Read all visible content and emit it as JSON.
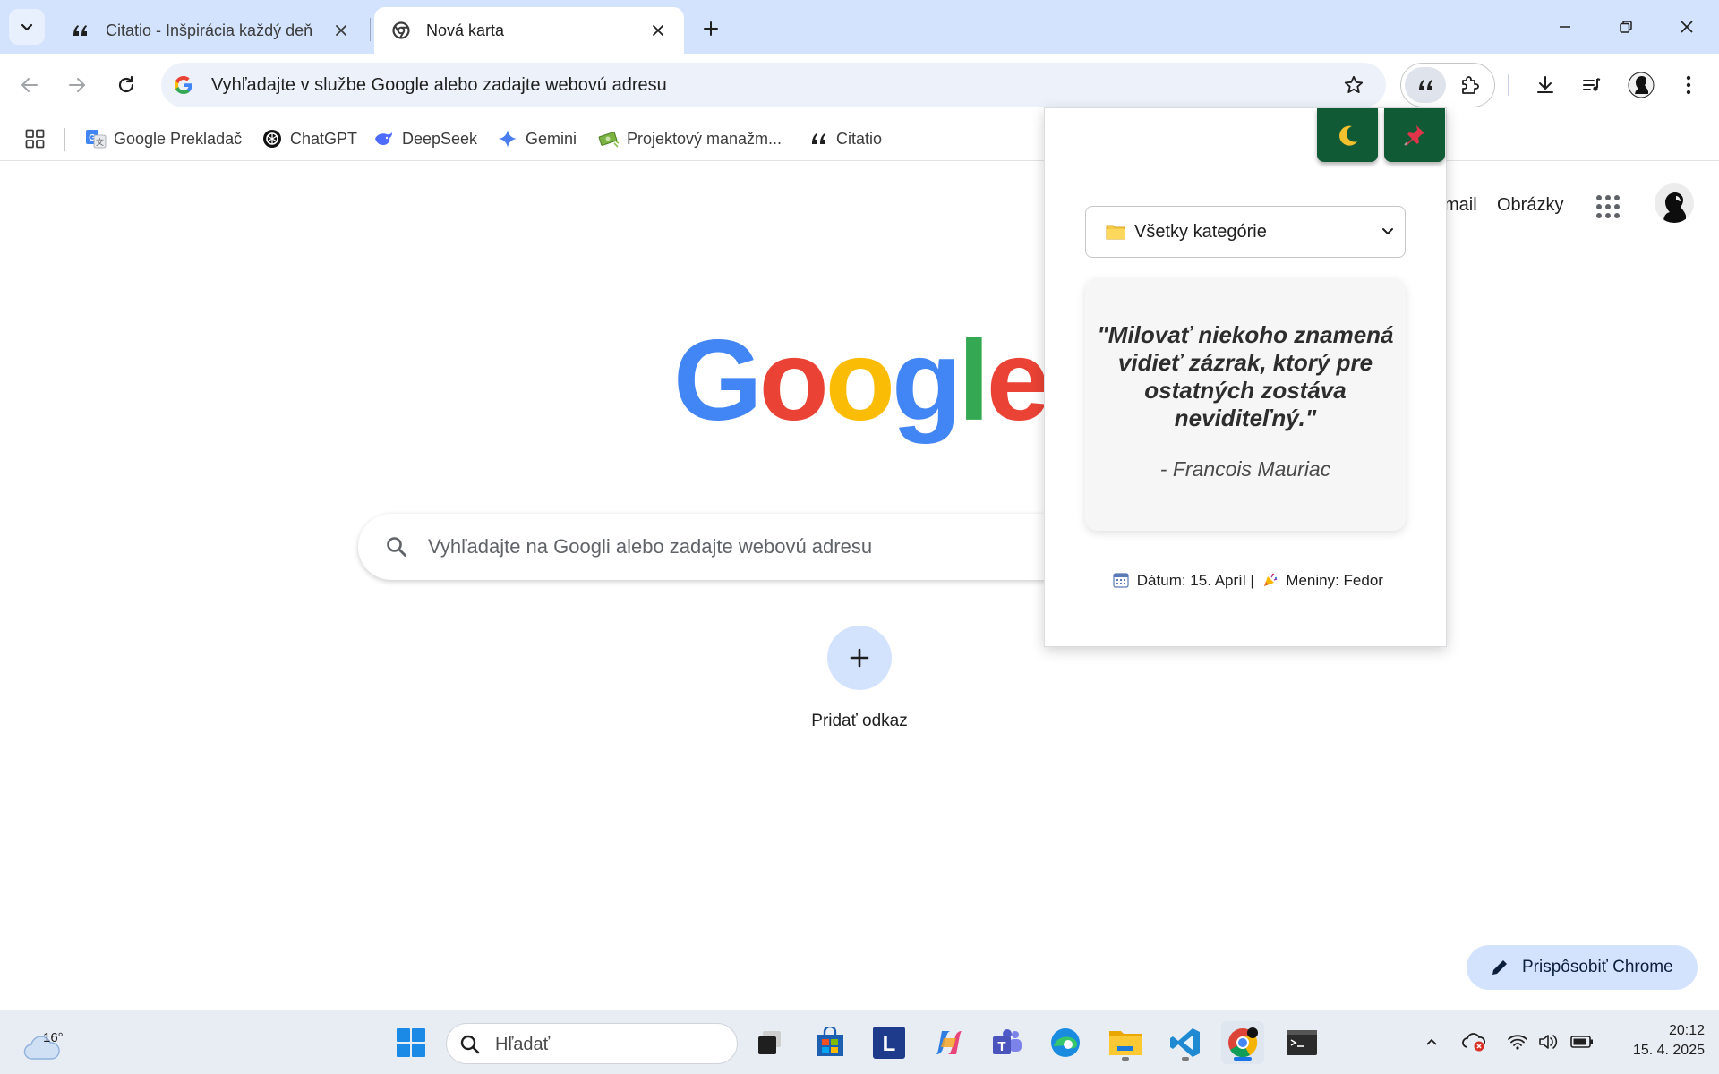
{
  "browser": {
    "tabs": [
      {
        "title": "Citatio - Inšpirácia každý deň",
        "icon": "quote-icon",
        "active": false
      },
      {
        "title": "Nová karta",
        "icon": "chrome-icon",
        "active": true
      }
    ],
    "address_bar": {
      "placeholder": "Vyhľadajte v službe Google alebo zadajte webovú adresu"
    },
    "bookmarks": [
      {
        "label": "Google Prekladač",
        "icon": "google-translate-icon"
      },
      {
        "label": "ChatGPT",
        "icon": "chatgpt-icon"
      },
      {
        "label": "DeepSeek",
        "icon": "deepseek-icon"
      },
      {
        "label": "Gemini",
        "icon": "gemini-icon"
      },
      {
        "label": "Projektový manažm...",
        "icon": "money-icon"
      },
      {
        "label": "Citatio",
        "icon": "quote-icon"
      }
    ]
  },
  "newtab": {
    "links": {
      "gmail": "mail",
      "images": "Obrázky"
    },
    "logo_text": "Google",
    "search_placeholder": "Vyhľadajte na Googli alebo zadajte webovú adresu",
    "add_shortcut_label": "Pridať odkaz",
    "customize_label": "Prispôsobiť Chrome"
  },
  "popup": {
    "category": "Všetky kategórie",
    "quote": "\"Milovať niekoho znamená vidieť zázrak, ktorý pre ostatných zostáva neviditeľný.\"",
    "author": "- Francois Mauriac",
    "date_text": "Dátum: 15. Apríl |",
    "nameday_text": "Meniny: Fedor",
    "dark_mode_icon": "moon-icon",
    "pin_icon": "pushpin-icon"
  },
  "taskbar": {
    "temperature": "16°",
    "search_placeholder": "Hľadať",
    "time": "20:12",
    "date": "15. 4. 2025"
  },
  "colors": {
    "tabstrip": "#d3e3fd",
    "popup_button": "#115a36",
    "google_blue": "#4285f4",
    "google_red": "#ea4335",
    "google_yellow": "#fbbc05",
    "google_green": "#34a853"
  }
}
